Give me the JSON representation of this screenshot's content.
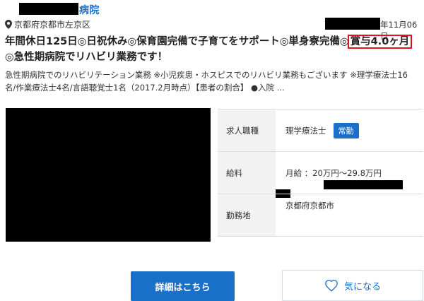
{
  "header": {
    "hospital_suffix": "病院",
    "location": "京都府京都市左京区",
    "date_suffix": "年11月06日"
  },
  "job": {
    "title_line1_prefix": "年間休日125日◎日祝休み◎保育園完備で子育てをサポート◎単身寮完備◎",
    "title_highlight": "賞与4.0ヶ月",
    "title_line2": "◎急性期病院でリハビリ業務です！",
    "summary": "急性期病院でのリハビリテーション業務 ※小児疾患・ホスピスでのリハビリ業務もございます ※理学療法士16名/作業療法士4名/言語聴覚士1名（2017.2月時点）【患者の割合】 ●入院 ..."
  },
  "info": {
    "rows": [
      {
        "label": "求人職種",
        "value": "理学療法士",
        "badge": "常勤"
      },
      {
        "label": "給料",
        "value": "月給 ：20万円〜29.8万円"
      },
      {
        "label": "勤務地",
        "value": "京都府京都市"
      }
    ]
  },
  "buttons": {
    "detail": "詳細はこちら",
    "favorite": "気になる"
  },
  "colors": {
    "accent": "#1a6fc9",
    "highlight_border": "#e0141e"
  }
}
